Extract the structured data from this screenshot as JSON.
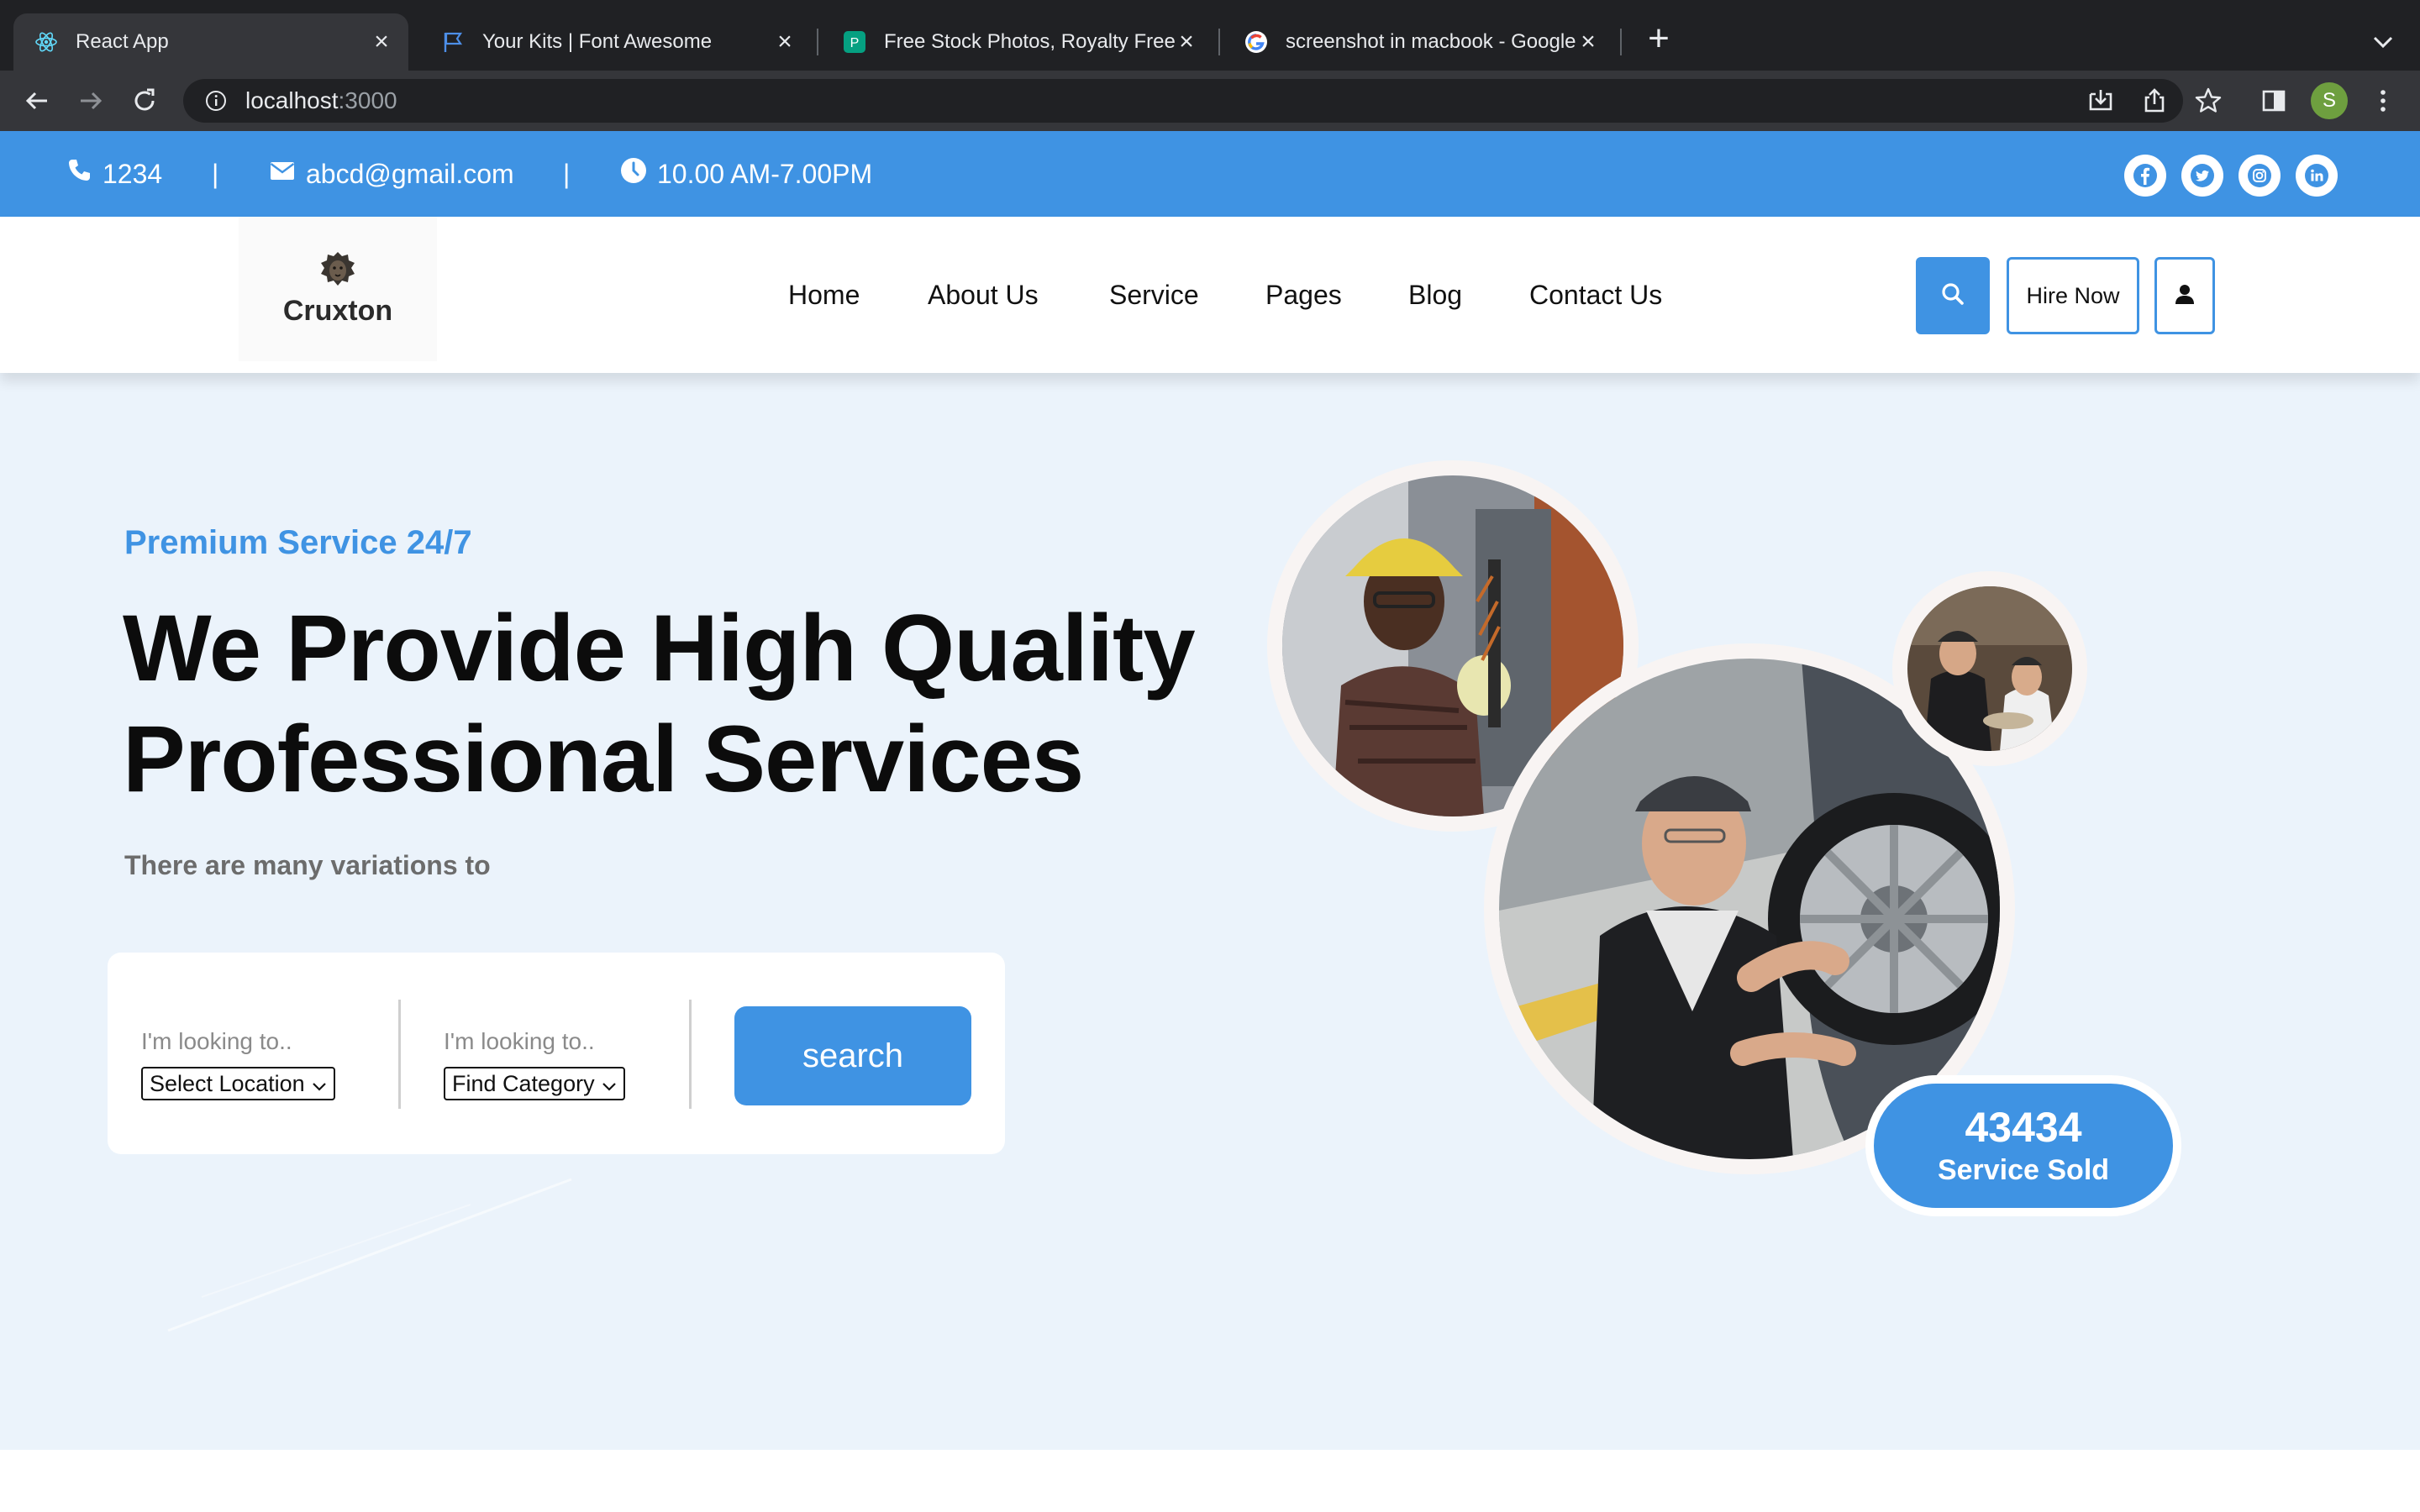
{
  "browser": {
    "tabs": [
      {
        "title": "React App",
        "active": true,
        "icon": "react-icon"
      },
      {
        "title": "Your Kits | Font Awesome",
        "active": false,
        "icon": "flag-icon"
      },
      {
        "title": "Free Stock Photos, Royalty Free",
        "active": false,
        "icon": "pexels-icon"
      },
      {
        "title": "screenshot in macbook - Google",
        "active": false,
        "icon": "google-icon"
      }
    ],
    "url_host": "localhost",
    "url_port": ":3000",
    "profile_initial": "S"
  },
  "topbar": {
    "phone": "1234",
    "email": "abcd@gmail.com",
    "hours": "10.00 AM-7.00PM",
    "separator": "|",
    "social": [
      "facebook-icon",
      "twitter-icon",
      "instagram-icon",
      "linkedin-icon"
    ]
  },
  "header": {
    "logo_text": "Cruxton",
    "nav": [
      "Home",
      "About Us",
      "Service",
      "Pages",
      "Blog",
      "Contact Us"
    ],
    "hire_label": "Hire Now"
  },
  "hero": {
    "tagline": "Premium Service 24/7",
    "headline_line1": "We Provide High Quality",
    "headline_line2": "Professional Services",
    "subtext": "There are many variations to",
    "search": {
      "location_label": "I'm looking to..",
      "location_value": "Select Location",
      "category_label": "I'm looking to..",
      "category_value": "Find Category",
      "button_label": "search"
    },
    "stat": {
      "number": "43434",
      "label": "Service Sold"
    }
  },
  "colors": {
    "brand_blue": "#3f93e3",
    "hero_bg": "#ebf3fb",
    "chrome_dark": "#202124"
  }
}
